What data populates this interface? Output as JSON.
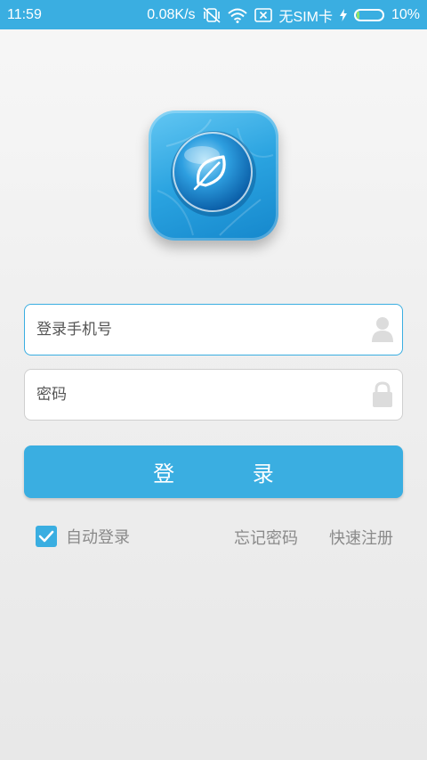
{
  "status_bar": {
    "time": "11:59",
    "network_speed": "0.08K/s",
    "sim": "无SIM卡",
    "battery": "10%",
    "battery_level": 0.1,
    "icons": [
      "mute-vibrate-icon",
      "wifi-icon",
      "no-sim-icon",
      "charging-icon",
      "battery-icon"
    ]
  },
  "login": {
    "phone_placeholder": "登录手机号",
    "phone_value": "",
    "password_placeholder": "密码",
    "password_value": "",
    "login_button": "登 录",
    "auto_login_label": "自动登录",
    "auto_login_checked": true,
    "forgot_password": "忘记密码",
    "quick_register": "快速注册"
  },
  "colors": {
    "accent": "#3aaee1",
    "text_muted": "#8a8a8a",
    "background": "#efefef"
  }
}
